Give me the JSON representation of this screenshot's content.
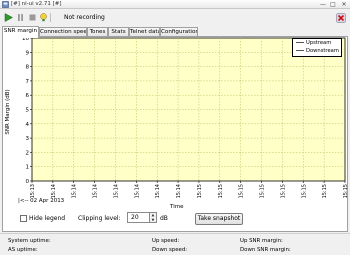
{
  "window": {
    "title": "[#] ni-ui v2.71 [#]"
  },
  "window_controls": {
    "minimize": "—",
    "maximize": "□",
    "close": "✕"
  },
  "toolbar": {
    "status_text": "Not recording",
    "icons": [
      "play-icon",
      "pause-icon",
      "stop-icon",
      "bulb-icon",
      "disconnect-icon"
    ]
  },
  "tabs": [
    {
      "label": "SNR margin",
      "active": true
    },
    {
      "label": "Connection speed",
      "active": false
    },
    {
      "label": "Tones",
      "active": false
    },
    {
      "label": "Stats",
      "active": false
    },
    {
      "label": "Telnet data",
      "active": false
    },
    {
      "label": "Configuration",
      "active": false
    }
  ],
  "chart": {
    "ylabel": "SNR Margin (dB)",
    "xlabel": "Time",
    "date_label": "|<-- 02 Apr 2013"
  },
  "chart_data": {
    "type": "line",
    "ylim": [
      0,
      10
    ],
    "yticks": [
      0,
      1,
      2,
      3,
      4,
      5,
      6,
      7,
      8,
      9,
      10
    ],
    "x_ticks": [
      "15:13",
      "15:14",
      "15:14",
      "15:14",
      "15:14",
      "15:14",
      "15:14",
      "15:14",
      "15:15",
      "15:15",
      "15:15",
      "15:15",
      "15:15",
      "15:15",
      "15:15",
      "15:15"
    ],
    "series": [
      {
        "name": "Upstream",
        "values": []
      },
      {
        "name": "Downstream",
        "values": []
      }
    ],
    "legend": "top-right",
    "grid": true,
    "background": "#ffffc8",
    "grid_color": "#b8b860"
  },
  "controls": {
    "hide_legend_label": "Hide legend",
    "hide_legend_checked": false,
    "clipping_label": "Clipping level:",
    "clipping_value": "20",
    "clipping_unit": "dB",
    "snapshot_label": "Take snapshot"
  },
  "stats": {
    "system_uptime": "System uptime:",
    "as_uptime": "AS uptime:",
    "up_speed": "Up speed:",
    "down_speed": "Down speed:",
    "up_snr": "Up SNR margin:",
    "down_snr": "Down SNR margin:"
  }
}
